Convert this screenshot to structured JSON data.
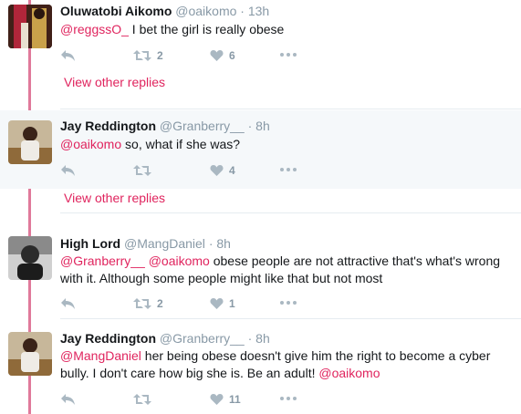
{
  "tweets": [
    {
      "name": "Oluwatobi Aikomo",
      "handle": "@oaikomo",
      "dot": "·",
      "time": "13h",
      "text_parts": [
        "@reggssO_",
        " I bet the girl is really obese"
      ],
      "retweets": "2",
      "likes": "6",
      "view_replies": "View other replies"
    },
    {
      "name": "Jay Reddington",
      "handle": "@Granberry__",
      "dot": "·",
      "time": "8h",
      "text_parts": [
        "@oaikomo",
        " so, what if she was?"
      ],
      "retweets": "",
      "likes": "4",
      "view_replies": "View other replies"
    },
    {
      "name": "High Lord",
      "handle": "@MangDaniel",
      "dot": "·",
      "time": "8h",
      "text_parts": [
        "@Granberry__",
        " ",
        "@oaikomo",
        " obese people are not attractive that's what's wrong with it. Although some people might like that but not most"
      ],
      "retweets": "2",
      "likes": "1"
    },
    {
      "name": "Jay Reddington",
      "handle": "@Granberry__",
      "dot": "·",
      "time": "8h",
      "text_parts": [
        "@MangDaniel",
        " her being obese doesn't give him the right to become a cyber bully. I don't care how big she is. Be an adult! ",
        "@oaikomo"
      ],
      "retweets": "",
      "likes": "11"
    }
  ],
  "colors": {
    "accent": "#e0245e",
    "thread_line": "#e0799a",
    "icon": "#aab8c2",
    "highlight_bg": "#f5f8fa"
  },
  "icons": {
    "reply": "reply-icon",
    "retweet": "retweet-icon",
    "like": "heart-icon",
    "more": "more-icon"
  }
}
